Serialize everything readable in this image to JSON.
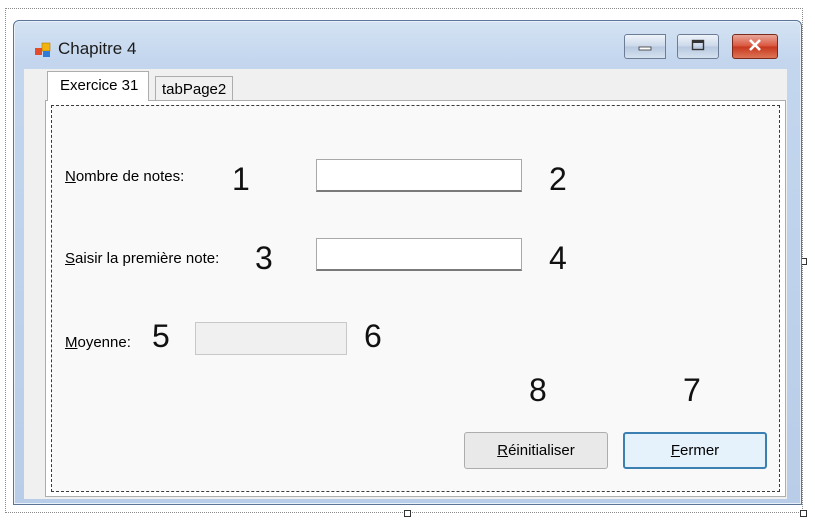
{
  "window": {
    "title": "Chapitre 4"
  },
  "tabs": [
    {
      "label": "Exercice 31"
    },
    {
      "label": "tabPage2"
    }
  ],
  "form": {
    "nombre_label_first": "N",
    "nombre_label_rest": "ombre de notes:",
    "nombre_value": "",
    "saisir_label_first": "S",
    "saisir_label_rest": "aisir la première note:",
    "saisir_value": "",
    "moyenne_label_first": "M",
    "moyenne_label_rest": "oyenne:",
    "moyenne_value": ""
  },
  "buttons": {
    "reset_first": "R",
    "reset_rest": "éinitialiser",
    "close_first": "F",
    "close_rest": "ermer"
  },
  "annotations": {
    "n1": "1",
    "n2": "2",
    "n3": "3",
    "n4": "4",
    "n5": "5",
    "n6": "6",
    "n7": "7",
    "n8": "8"
  },
  "colors": {
    "title_bar": "#c3d6ee",
    "close_button": "#d9533b",
    "primary_button_border": "#3c7fb1",
    "tab_page_background": "#f9f9f9"
  },
  "icons": {
    "app": "windows-form-icon",
    "minimize": "minimize-icon",
    "maximize": "maximize-icon",
    "close": "close-icon"
  }
}
